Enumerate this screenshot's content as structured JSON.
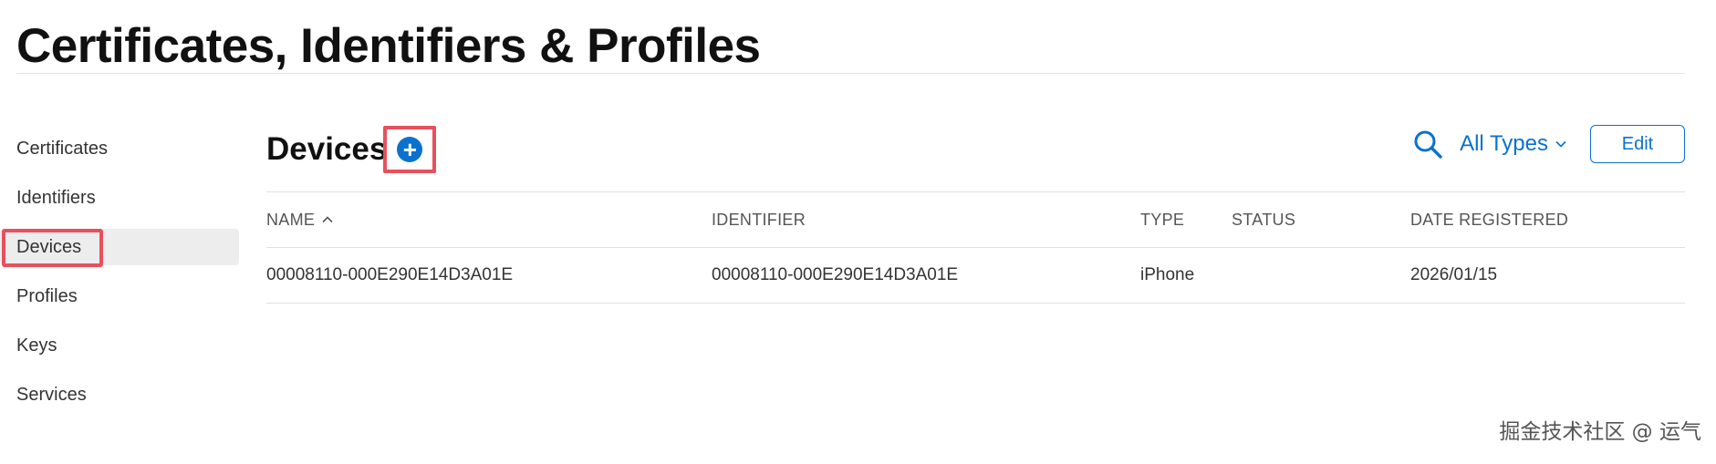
{
  "page": {
    "title": "Certificates, Identifiers & Profiles"
  },
  "sidebar": {
    "items": [
      {
        "label": "Certificates"
      },
      {
        "label": "Identifiers"
      },
      {
        "label": "Devices"
      },
      {
        "label": "Profiles"
      },
      {
        "label": "Keys"
      },
      {
        "label": "Services"
      }
    ],
    "active": "Devices"
  },
  "main": {
    "heading": "Devices",
    "add_icon": "plus-circle-icon",
    "search_icon": "search-icon",
    "filter": {
      "selected": "All Types",
      "icon": "chevron-down-icon"
    },
    "edit_label": "Edit"
  },
  "table": {
    "columns": [
      "NAME",
      "IDENTIFIER",
      "TYPE",
      "STATUS",
      "DATE REGISTERED"
    ],
    "sort_icon": "chevron-up-icon",
    "rows": [
      {
        "name": "00008110-000E290E14D3A01E",
        "identifier": "00008110-000E290E14D3A01E",
        "type": "iPhone",
        "status": "",
        "date": "2026/01/15"
      }
    ]
  },
  "watermark": "掘金技术社区 @ 运气",
  "colors": {
    "accent": "#0b71ce",
    "highlight": "#e8505b",
    "active_bg": "#ededee"
  }
}
